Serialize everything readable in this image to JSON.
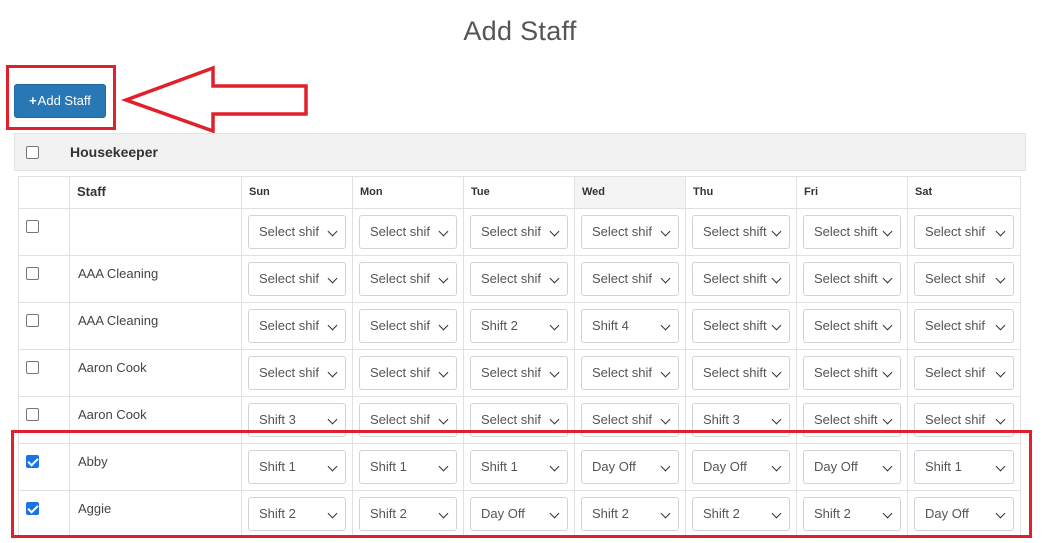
{
  "page": {
    "title": "Add Staff"
  },
  "toolbar": {
    "add_staff_label": "Add Staff",
    "add_icon": "plus-icon"
  },
  "annotation": {
    "arrow_color": "#e0202a",
    "highlight_color": "#e0202a"
  },
  "group": {
    "label": "Housekeeper",
    "checked": false
  },
  "table": {
    "headers": {
      "staff": "Staff",
      "days": [
        "Sun",
        "Mon",
        "Tue",
        "Wed",
        "Thu",
        "Fri",
        "Sat"
      ]
    },
    "rows": [
      {
        "name": "",
        "checked": false,
        "shifts": [
          "Select shif",
          "Select shif",
          "Select shif",
          "Select shif",
          "Select shift",
          "Select shift",
          "Select shif"
        ]
      },
      {
        "name": "AAA Cleaning",
        "checked": false,
        "shifts": [
          "Select shif",
          "Select shif",
          "Select shif",
          "Select shif",
          "Select shift",
          "Select shift",
          "Select shif"
        ]
      },
      {
        "name": "AAA Cleaning",
        "checked": false,
        "shifts": [
          "Select shif",
          "Select shif",
          "Shift 2",
          "Shift 4",
          "Select shift",
          "Select shift",
          "Select shif"
        ]
      },
      {
        "name": "Aaron Cook",
        "checked": false,
        "shifts": [
          "Select shif",
          "Select shif",
          "Select shif",
          "Select shif",
          "Select shift",
          "Select shift",
          "Select shif"
        ]
      },
      {
        "name": "Aaron Cook",
        "checked": false,
        "shifts": [
          "Shift 3",
          "Select shif",
          "Select shif",
          "Select shif",
          "Shift 3",
          "Select shift",
          "Select shif"
        ]
      },
      {
        "name": "Abby",
        "checked": true,
        "shifts": [
          "Shift 1",
          "Shift 1",
          "Shift 1",
          "Day Off",
          "Day Off",
          "Day Off",
          "Shift 1"
        ]
      },
      {
        "name": "Aggie",
        "checked": true,
        "shifts": [
          "Shift 2",
          "Shift 2",
          "Day Off",
          "Shift 2",
          "Shift 2",
          "Shift 2",
          "Day Off"
        ]
      }
    ]
  }
}
